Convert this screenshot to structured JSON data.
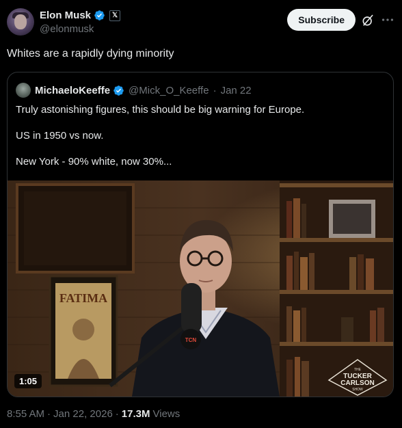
{
  "author": {
    "name": "Elon Musk",
    "handle": "@elonmusk",
    "affiliate_badge": "𝕏"
  },
  "actions": {
    "subscribe_label": "Subscribe"
  },
  "tweet": {
    "text": "Whites are a rapidly dying minority"
  },
  "quoted": {
    "name": "MichaeloKeeffe",
    "handle": "@Mick_O_Keeffe",
    "separator": "·",
    "date": "Jan 22",
    "lines": [
      "Truly astonishing figures, this should be big warning for Europe.",
      "US in 1950 vs now.",
      "New York - 90% white, now 30%..."
    ],
    "video": {
      "duration": "1:05",
      "poster_text": "FATIMA",
      "watermark": {
        "top": "THE",
        "line1": "TUCKER",
        "line2": "CARLSON",
        "bottom": "SHOW"
      },
      "mic_label": "TCN"
    }
  },
  "meta": {
    "time": "8:55 AM",
    "separator": "·",
    "date": "Jan 22, 2026",
    "separator2": "·",
    "views_count": "17.3M",
    "views_label": "Views"
  },
  "colors": {
    "verified": "#1d9bf0",
    "background": "#000000",
    "text": "#e7e9ea",
    "muted": "#71767b",
    "border": "#2f3336"
  }
}
